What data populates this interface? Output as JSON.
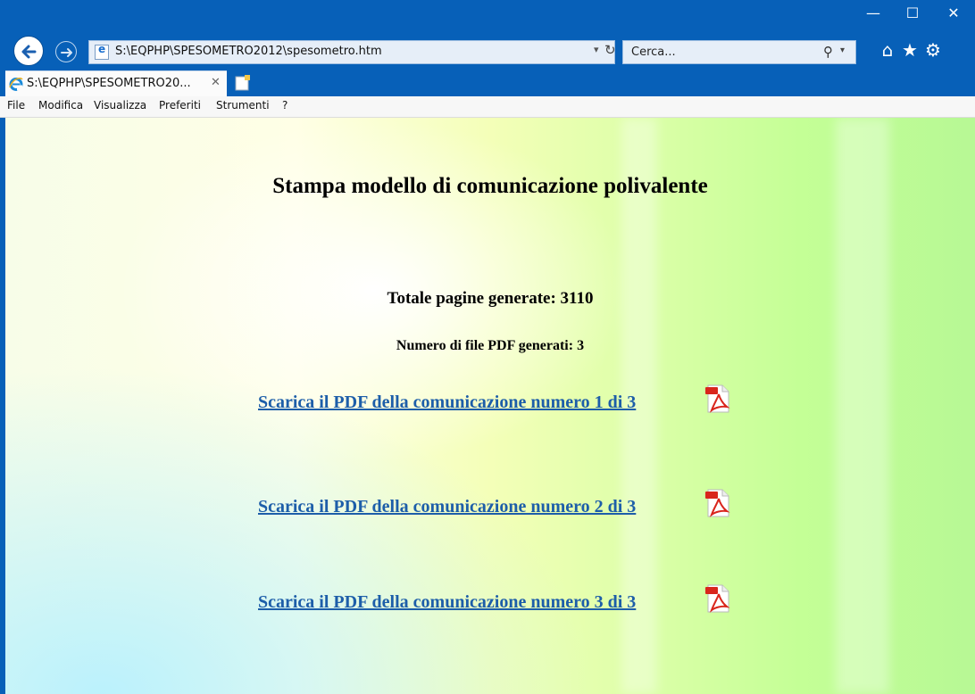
{
  "window": {
    "minimize_glyph": "—",
    "maximize_glyph": "☐",
    "close_glyph": "✕"
  },
  "address": {
    "url": "S:\\EQPHP\\SPESOMETRO2012\\spesometro.htm",
    "dropdown_glyph": "▾",
    "refresh_glyph": "↻"
  },
  "search": {
    "placeholder": "Cerca...",
    "icon_glyph": "⚲",
    "dropdown_glyph": "▾"
  },
  "toolbar": {
    "home_glyph": "⌂",
    "favorites_glyph": "★",
    "settings_glyph": "⚙"
  },
  "tab": {
    "title": "S:\\EQPHP\\SPESOMETRO20...",
    "close_glyph": "✕"
  },
  "menu": {
    "items": [
      "File",
      "Modifica",
      "Visualizza",
      "Preferiti",
      "Strumenti",
      "?"
    ]
  },
  "page": {
    "heading": "Stampa modello di comunicazione polivalente",
    "total_pages": "Totale pagine generate: 3110",
    "num_files": "Numero di file PDF generati: 3",
    "downloads": [
      "Scarica il PDF della comunicazione numero 1 di 3",
      "Scarica il PDF della comunicazione numero 2 di 3",
      "Scarica il PDF della comunicazione numero 3 di 3"
    ]
  },
  "colors": {
    "chrome": "#0760b8",
    "link": "#1d5ea9",
    "pdf_red": "#d9251c"
  },
  "icons": [
    "back-arrow-icon",
    "forward-arrow-icon",
    "ie-page-icon",
    "refresh-icon",
    "search-icon",
    "home-icon",
    "favorites-star-icon",
    "settings-gear-icon",
    "close-icon",
    "new-tab-icon",
    "pdf-icon"
  ]
}
